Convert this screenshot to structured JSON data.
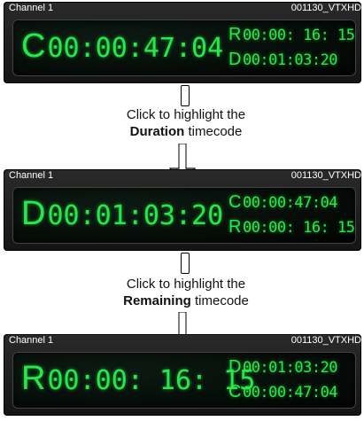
{
  "panels": [
    {
      "channel": "Channel 1",
      "clip": "001130_VTXHD",
      "main": {
        "letter": "C",
        "time": "00:00:47:04"
      },
      "sub1": {
        "letter": "R",
        "time": "00:00: 16: 15"
      },
      "sub2": {
        "letter": "D",
        "time": "00:01:03:20"
      }
    },
    {
      "channel": "Channel 1",
      "clip": "001130_VTXHD",
      "main": {
        "letter": "D",
        "time": "00:01:03:20"
      },
      "sub1": {
        "letter": "C",
        "time": "00:00:47:04"
      },
      "sub2": {
        "letter": "R",
        "time": "00:00: 16: 15"
      }
    },
    {
      "channel": "Channel 1",
      "clip": "001130_VTXHD",
      "main": {
        "letter": "R",
        "time": "00:00: 16: 15"
      },
      "sub1": {
        "letter": "D",
        "time": "00:01:03:20"
      },
      "sub2": {
        "letter": "C",
        "time": "00:00:47:04"
      }
    }
  ],
  "captions": [
    {
      "line1": "Click to highlight the",
      "bold": "Duration",
      "rest": " timecode"
    },
    {
      "line1": "Click to highlight the",
      "bold": "Remaining",
      "rest": " timecode"
    }
  ],
  "colors": {
    "lcd_green": "#27e84a",
    "panel_bg": "#1c1c1c"
  }
}
